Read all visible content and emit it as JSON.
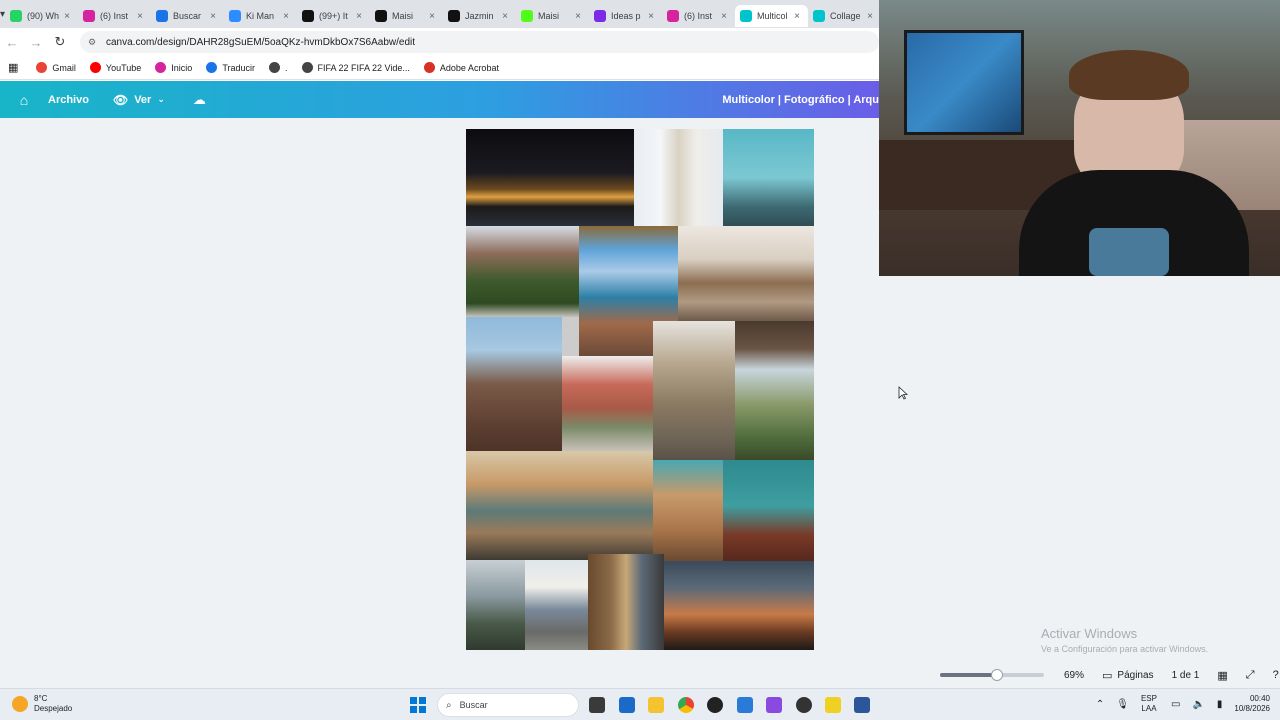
{
  "browser": {
    "tabs": [
      {
        "title": "(90) Wh",
        "icon": "whatsapp-icon",
        "color": "#25d366"
      },
      {
        "title": "(6) Inst",
        "icon": "instagram-icon",
        "color": "#d6249f"
      },
      {
        "title": "Buscar",
        "icon": "chrome-icon",
        "color": "#1a73e8"
      },
      {
        "title": "Ki Man",
        "icon": "video-icon",
        "color": "#2d8cff"
      },
      {
        "title": "(99+) It",
        "icon": "tiktok-icon",
        "color": "#111111"
      },
      {
        "title": "Maisi",
        "icon": "tiktok-icon",
        "color": "#111111"
      },
      {
        "title": "Jazmin",
        "icon": "tiktok-icon",
        "color": "#111111"
      },
      {
        "title": "Maisi",
        "icon": "kick-icon",
        "color": "#53fc18"
      },
      {
        "title": "Ideas p",
        "icon": "canva-icon",
        "color": "#7d2ae8"
      },
      {
        "title": "(6) Inst",
        "icon": "instagram-icon",
        "color": "#d6249f"
      },
      {
        "title": "Multicol",
        "icon": "canva-icon",
        "color": "#00c4cc"
      },
      {
        "title": "Collage",
        "icon": "canva-icon",
        "color": "#00c4cc"
      }
    ],
    "active_tab_index": 10,
    "url": "canva.com/design/DAHR28gSuEM/5oaQKz-hvmDkbOx7S6Aabw/edit",
    "bookmarks": [
      {
        "label": "Gmail",
        "color": "#ea4335"
      },
      {
        "label": "YouTube",
        "color": "#ff0000"
      },
      {
        "label": "Inicio",
        "color": "#d6249f"
      },
      {
        "label": "Traducir",
        "color": "#1a73e8"
      },
      {
        "label": ".",
        "color": "#444444"
      },
      {
        "label": "FIFA 22 FIFA 22 Vide...",
        "color": "#444444"
      },
      {
        "label": "Adobe Acrobat",
        "color": "#d93025"
      }
    ]
  },
  "canva": {
    "menu_archivo": "Archivo",
    "menu_ver": "Ver",
    "doc_title": "Multicolor | Fotográfico | Arqu"
  },
  "footer": {
    "zoom": "69%",
    "zoom_fraction": 0.55,
    "pages_label": "Páginas",
    "page_count": "1 de 1"
  },
  "watermark": {
    "line1": "Activar Windows",
    "line2": "Ve a Configuración para activar Windows."
  },
  "taskbar": {
    "weather_temp": "8°C",
    "weather_text": "Despejado",
    "search": "Buscar",
    "lang1": "ESP",
    "lang2": "LAA",
    "time": "00:40",
    "date": "10/8/2026"
  }
}
